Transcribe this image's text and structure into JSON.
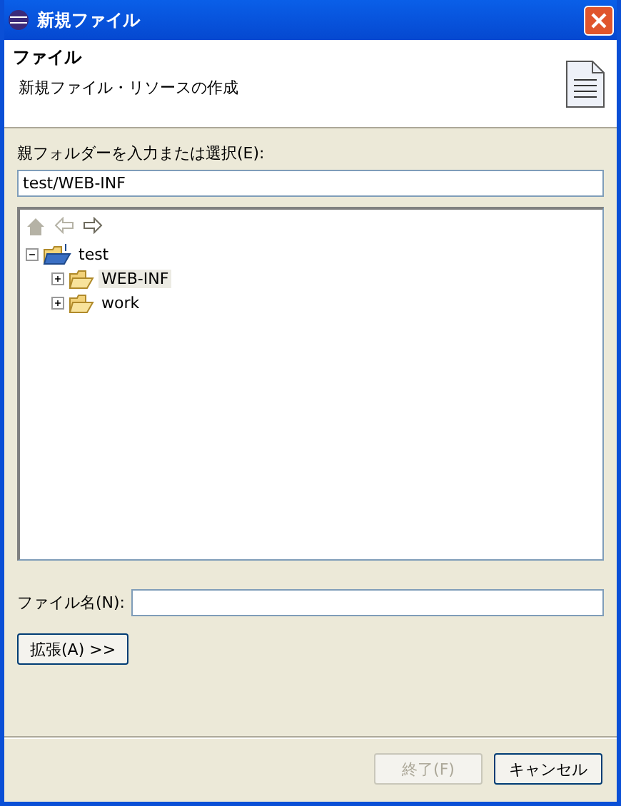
{
  "window": {
    "title": "新規ファイル"
  },
  "header": {
    "title": "ファイル",
    "description": "新規ファイル・リソースの作成"
  },
  "parent_folder": {
    "label": "親フォルダーを入力または選択(E):",
    "value": "test/WEB-INF"
  },
  "toolbar": [
    {
      "kind": "home",
      "disabled": true
    },
    {
      "kind": "back",
      "disabled": true
    },
    {
      "kind": "forward",
      "disabled": false
    }
  ],
  "tree": [
    {
      "label": "test",
      "kind": "project",
      "expanded": true,
      "selected": false,
      "children": [
        {
          "label": "WEB-INF",
          "kind": "folder",
          "expanded": false,
          "selected": true
        },
        {
          "label": "work",
          "kind": "folder",
          "expanded": false,
          "selected": false
        }
      ]
    }
  ],
  "file_name": {
    "label": "ファイル名(N):"
  },
  "advanced_button": "拡張(A) >>",
  "buttons": [
    {
      "label": "終了(F)",
      "disabled": true
    },
    {
      "label": "キャンセル",
      "disabled": false
    }
  ]
}
